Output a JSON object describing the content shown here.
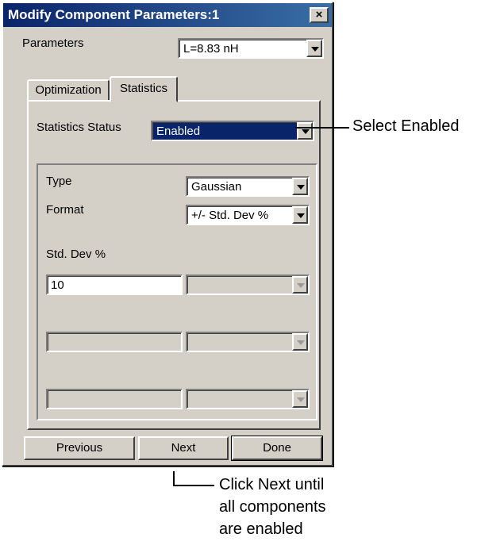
{
  "dialog": {
    "title": "Modify Component Parameters:1",
    "close_label": "×"
  },
  "parameters": {
    "label": "Parameters",
    "value": "L=8.83 nH"
  },
  "tabs": [
    {
      "label": "Optimization",
      "active": false
    },
    {
      "label": "Statistics",
      "active": true
    }
  ],
  "statistics": {
    "status_label": "Statistics Status",
    "status_value": "Enabled",
    "type_label": "Type",
    "type_value": "Gaussian",
    "format_label": "Format",
    "format_value": "+/- Std. Dev %",
    "stddev_label": "Std. Dev %",
    "stddev_value": "10"
  },
  "buttons": {
    "previous": "Previous",
    "next": "Next",
    "done": "Done"
  },
  "annotations": {
    "select_enabled": "Select Enabled",
    "click_next_line1": "Click Next until",
    "click_next_line2": "all components",
    "click_next_line3": "are enabled"
  },
  "colors": {
    "dialog_bg": "#d4d0c8",
    "titlebar": "#0a246a",
    "selection": "#0a246a"
  }
}
